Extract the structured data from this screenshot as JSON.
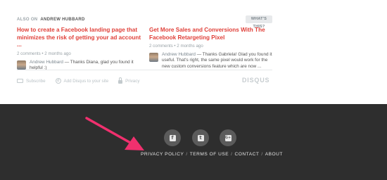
{
  "recommendations": {
    "also_on_prefix": "ALSO ON",
    "also_on_author": "ANDREW HUBBARD",
    "whats_this": "WHAT'S THIS?",
    "cards": [
      {
        "title": "How to create a Facebook landing page that minimizes the risk of getting your ad account ...",
        "meta": "2 comments • 2 months ago",
        "commenter": "Andrew Hubbard",
        "comment": " — Thanks Diana, glad you found it helpful :)"
      },
      {
        "title": "Get More Sales and Conversions With The Facebook Retargeting Pixel",
        "meta": "2 comments • 2 months ago",
        "commenter": "Andrew Hubbard",
        "comment": " — Thanks Gabriela! Glad you found it useful. That's right, the same pixel would work for the new custom conversions feature which are now ..."
      }
    ]
  },
  "disqus_footer": {
    "subscribe": "Subscribe",
    "add_disqus": "Add Disqus to your site",
    "privacy": "Privacy",
    "logo": "DISQUS"
  },
  "site_footer": {
    "social": [
      {
        "icon": "facebook-icon",
        "glyph": "f"
      },
      {
        "icon": "twitter-icon",
        "glyph": "t"
      },
      {
        "icon": "google-plus-icon",
        "glyph": "G+"
      }
    ],
    "links": {
      "privacy_policy": "PRIVACY POLICY",
      "terms_of_use": "TERMS OF USE",
      "contact": "CONTACT",
      "about": "ABOUT",
      "separator": "/"
    }
  },
  "colors": {
    "accent_red": "#e0413a",
    "arrow_pink": "#f0306e",
    "footer_bg": "#2e2e2e",
    "social_circle": "#5b5b5b"
  }
}
